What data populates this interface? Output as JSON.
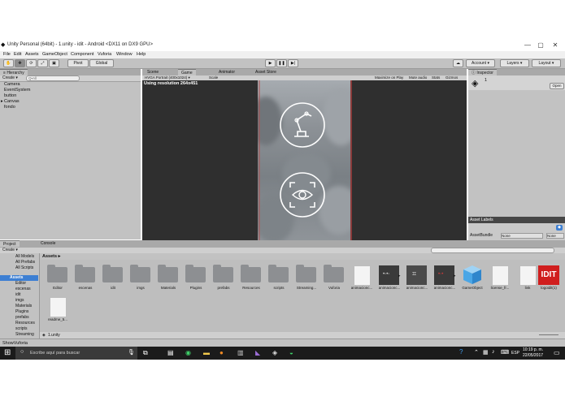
{
  "window": {
    "title": "Unity Personal (64bit) - 1.unity - idit - Android <DX11 on DX9 GPU>",
    "minimize": "—",
    "maximize": "▢",
    "close": "✕"
  },
  "menu": [
    "File",
    "Edit",
    "Assets",
    "GameObject",
    "Component",
    "Vuforia",
    "Window",
    "Help"
  ],
  "toolbar": {
    "pivot": "Pivot",
    "global": "Global",
    "account": "Account",
    "layers": "Layers",
    "layout": "Layout"
  },
  "hierarchy": {
    "tab": "Hierarchy",
    "create": "Create",
    "search_placeholder": "Q•All",
    "items": [
      "Camera",
      "EventSystem",
      "button",
      "Canvas",
      "fondo"
    ]
  },
  "scene_tabs": [
    "Scene",
    "Game",
    "Animator",
    "Asset Store"
  ],
  "game": {
    "resolution_select": "HVGA Portrait (400x1024)",
    "scale_label": "Scale",
    "using_resolution": "Using resolution 264x451",
    "toggles": [
      "Maximize on Play",
      "Mute audio",
      "Stats",
      "Gizmos"
    ]
  },
  "inspector": {
    "tab": "Inspector",
    "item_name": "1",
    "open_button": "Open",
    "asset_labels": "Asset Labels",
    "assetbundle_label": "AssetBundle",
    "assetbundle_value": "None",
    "assetbundle_variant": "None"
  },
  "project": {
    "tabs": [
      "Project",
      "Console"
    ],
    "create": "Create",
    "favorites": [
      "All Models",
      "All Prefabs",
      "All Scripts"
    ],
    "tree_root": "Assets",
    "tree_items": [
      "Editor",
      "escenas",
      "idit",
      "imgs",
      "Materials",
      "Plugins",
      "prefabs",
      "Resources",
      "scripts",
      "Streaming"
    ],
    "breadcrumb": "Assets",
    "assets": [
      {
        "label": "Editor",
        "kind": "folder"
      },
      {
        "label": "escenas",
        "kind": "folder"
      },
      {
        "label": "idit",
        "kind": "folder"
      },
      {
        "label": "imgs",
        "kind": "folder"
      },
      {
        "label": "Materials",
        "kind": "folder"
      },
      {
        "label": "Plugins",
        "kind": "folder"
      },
      {
        "label": "prefabs",
        "kind": "folder"
      },
      {
        "label": "Resources",
        "kind": "folder"
      },
      {
        "label": "scripts",
        "kind": "folder"
      },
      {
        "label": "Streaming...",
        "kind": "folder"
      },
      {
        "label": "Vuforia",
        "kind": "folder"
      },
      {
        "label": "animacionc...",
        "kind": "doc"
      },
      {
        "label": "animacionc...",
        "kind": "anim"
      },
      {
        "label": "animacionc...",
        "kind": "anim2"
      },
      {
        "label": "animacionc...",
        "kind": "anim3"
      },
      {
        "label": "GameObject",
        "kind": "cube"
      },
      {
        "label": "license_fr...",
        "kind": "doc"
      },
      {
        "label": "link",
        "kind": "doc"
      },
      {
        "label": "logoidit(1)",
        "kind": "logo"
      },
      {
        "label": "readme_5...",
        "kind": "doc"
      }
    ],
    "logo_text": "IDIT",
    "footer_file": "1.unity"
  },
  "status": {
    "text": "ShowVuforia"
  },
  "taskbar": {
    "search_placeholder": "Escribe aquí para buscar",
    "language": "ESP",
    "time": "10:19 p. m.",
    "date": "22/05/2017"
  },
  "colors": {
    "editor_bg": "#c2c2c2",
    "game_bg": "#2f2f2f",
    "selection": "#3d7fd3",
    "logo_red": "#d01e1e"
  }
}
